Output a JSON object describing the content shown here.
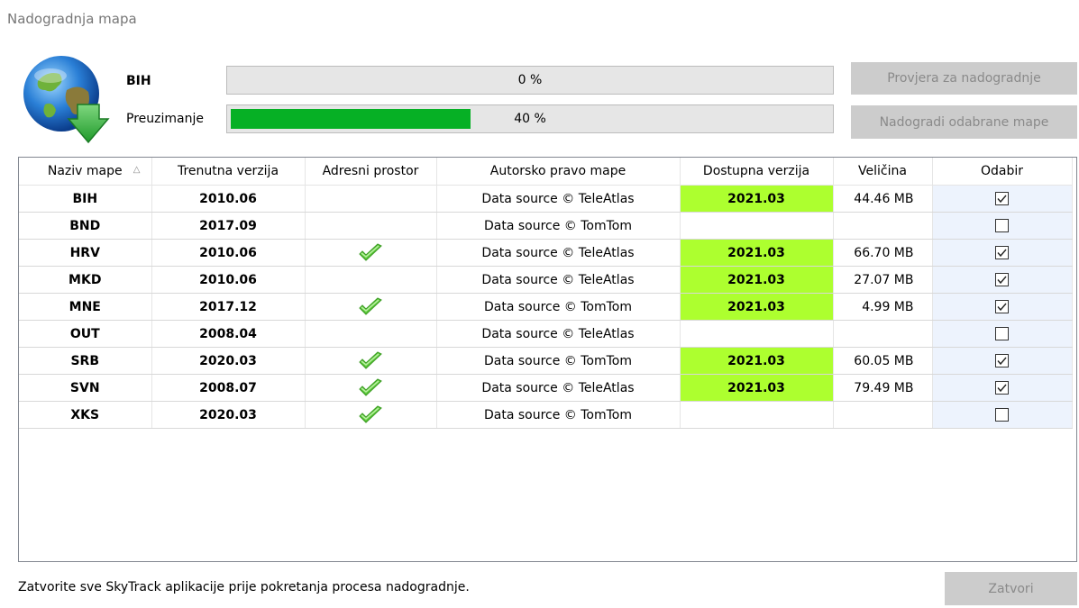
{
  "window": {
    "title": "Nadogradnja mapa"
  },
  "status": {
    "map_name": "BIH",
    "map_progress_value": 0,
    "map_progress_label": "0 %",
    "download_label": "Preuzimanje",
    "download_progress_value": 40,
    "download_progress_label": "40 %"
  },
  "buttons": {
    "check_updates": "Provjera za nadogradnje",
    "update_selected": "Nadogradi odabrane mape",
    "close": "Zatvori"
  },
  "table": {
    "columns": [
      "Naziv mape",
      "Trenutna verzija",
      "Adresni prostor",
      "Autorsko pravo mape",
      "Dostupna verzija",
      "Veličina",
      "Odabir"
    ],
    "sort_indicator": "△",
    "rows": [
      {
        "name": "BIH",
        "current": "2010.06",
        "address": false,
        "copyright": "Data source © TeleAtlas",
        "available": "2021.03",
        "size": "44.46 MB",
        "selected": true
      },
      {
        "name": "BND",
        "current": "2017.09",
        "address": false,
        "copyright": "Data source © TomTom",
        "available": "",
        "size": "",
        "selected": false
      },
      {
        "name": "HRV",
        "current": "2010.06",
        "address": true,
        "copyright": "Data source © TeleAtlas",
        "available": "2021.03",
        "size": "66.70 MB",
        "selected": true
      },
      {
        "name": "MKD",
        "current": "2010.06",
        "address": false,
        "copyright": "Data source © TeleAtlas",
        "available": "2021.03",
        "size": "27.07 MB",
        "selected": true
      },
      {
        "name": "MNE",
        "current": "2017.12",
        "address": true,
        "copyright": "Data source © TomTom",
        "available": "2021.03",
        "size": "4.99 MB",
        "selected": true
      },
      {
        "name": "OUT",
        "current": "2008.04",
        "address": false,
        "copyright": "Data source © TeleAtlas",
        "available": "",
        "size": "",
        "selected": false
      },
      {
        "name": "SRB",
        "current": "2020.03",
        "address": true,
        "copyright": "Data source © TomTom",
        "available": "2021.03",
        "size": "60.05 MB",
        "selected": true
      },
      {
        "name": "SVN",
        "current": "2008.07",
        "address": true,
        "copyright": "Data source © TeleAtlas",
        "available": "2021.03",
        "size": "79.49 MB",
        "selected": true
      },
      {
        "name": "XKS",
        "current": "2020.03",
        "address": true,
        "copyright": "Data source © TomTom",
        "available": "",
        "size": "",
        "selected": false
      }
    ]
  },
  "footer": {
    "note": "Zatvorite sve SkyTrack aplikacije prije pokretanja procesa nadogradnje."
  },
  "colors": {
    "progress_fill": "#06b025",
    "available_highlight": "#adff2f",
    "selection_column": "#edf3fd"
  }
}
